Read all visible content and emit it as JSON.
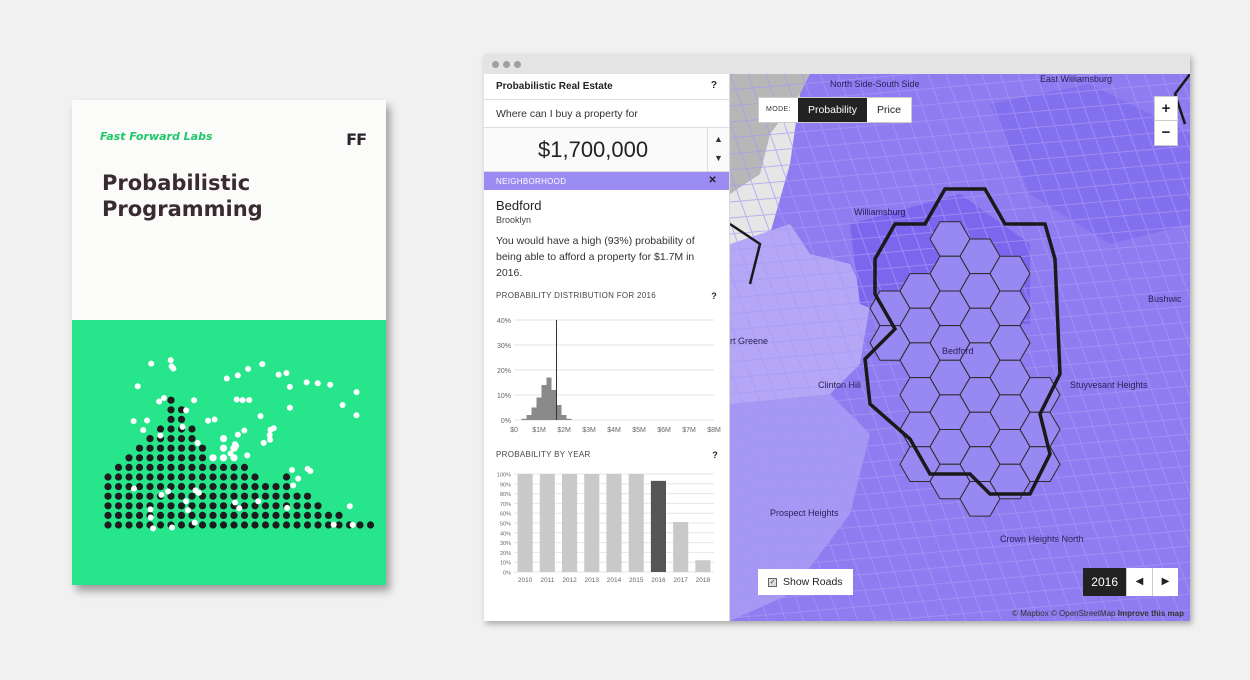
{
  "book": {
    "publisher": "Fast Forward Labs",
    "logo": "FF",
    "title_line1": "Probabilistic",
    "title_line2": "Programming"
  },
  "app": {
    "title": "Probabilistic Real Estate",
    "help_icon": "?",
    "question": "Where can I buy a property for",
    "price": "$1,700,000",
    "neighborhood_header": "NEIGHBORHOOD",
    "close_icon": "✕",
    "neighborhood_name": "Bedford",
    "borough": "Brooklyn",
    "description": "You would have a high (93%) probability of being able to afford a property for $1.7M in 2016.",
    "dist_title": "PROBABILITY DISTRIBUTION FOR 2016",
    "year_title": "PROBABILITY BY YEAR"
  },
  "chart_data": [
    {
      "type": "bar",
      "title": "PROBABILITY DISTRIBUTION FOR 2016",
      "x_tick_labels": [
        "$0",
        "$1M",
        "$2M",
        "$3M",
        "$4M",
        "$5M",
        "$6M",
        "$7M",
        "$8M"
      ],
      "y_tick_labels": [
        "40%",
        "30%",
        "20%",
        "10%",
        "0%"
      ],
      "ylim": [
        0,
        40
      ],
      "xlim": [
        0,
        8
      ],
      "x": [
        0.4,
        0.6,
        0.8,
        1.0,
        1.2,
        1.4,
        1.6,
        1.8,
        2.0,
        2.2
      ],
      "values": [
        0.5,
        2,
        5,
        9,
        14,
        17,
        12,
        6,
        2,
        0.5
      ],
      "marker_x": 1.7
    },
    {
      "type": "bar",
      "title": "PROBABILITY BY YEAR",
      "categories": [
        "2010",
        "2011",
        "2012",
        "2013",
        "2014",
        "2015",
        "2016",
        "2017",
        "2018"
      ],
      "values": [
        100,
        100,
        100,
        100,
        100,
        100,
        93,
        51,
        12
      ],
      "y_tick_labels": [
        "100%",
        "90%",
        "80%",
        "70%",
        "60%",
        "50%",
        "40%",
        "30%",
        "20%",
        "10%",
        "0%"
      ],
      "ylim": [
        0,
        100
      ],
      "highlight": "2016"
    }
  ],
  "map": {
    "mode_label": "MODE:",
    "mode_options": [
      "Probability",
      "Price"
    ],
    "mode_selected": "Probability",
    "zoom_in": "+",
    "zoom_out": "−",
    "show_roads": "Show Roads",
    "year": "2016",
    "prev": "◀",
    "next": "▶",
    "attribution_1": "© Mapbox © OpenStreetMap",
    "attribution_2": "Improve this map",
    "labels": {
      "north_side": "North Side-South Side",
      "east_wburg": "East Williamsburg",
      "williamsburg": "Williamsburg",
      "bushwick": "Bushwic",
      "fort_greene": "rt Greene",
      "clinton_hill": "Clinton Hill",
      "bedford": "Bedford",
      "stuyvesant": "Stuyvesant Heights",
      "prospect": "Prospect Heights",
      "crown": "Crown Heights North"
    },
    "colors": {
      "base": "#8f7cf0",
      "selected_outline": "#1a1a1a"
    }
  }
}
